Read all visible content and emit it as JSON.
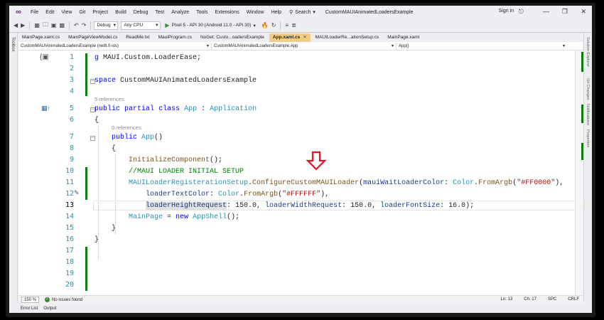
{
  "menu": [
    "File",
    "Edit",
    "View",
    "Git",
    "Project",
    "Build",
    "Debug",
    "Test",
    "Analyze",
    "Tools",
    "Extensions",
    "Window",
    "Help"
  ],
  "search_label": "Search",
  "solution_title": "CustomMAUIAnimatedLoadersExample",
  "sign_in": "Sign in",
  "toolbar": {
    "config": "Debug",
    "platform": "Any CPU",
    "run_target": "Pixel 5 - API 30 (Android 11.0 - API 30)"
  },
  "left_strip_label": "Toolbox",
  "right_strip_labels": [
    "Solution Explorer",
    "Git Changes",
    "Notifications",
    "Properties"
  ],
  "tabs": [
    {
      "label": "MainPage.xaml.cs",
      "active": false
    },
    {
      "label": "MainPageViewModel.cs",
      "active": false
    },
    {
      "label": "ReadMe.txt",
      "active": false
    },
    {
      "label": "MauiProgram.cs",
      "active": false
    },
    {
      "label": "NuGet: Custo...oadersExample",
      "active": false
    },
    {
      "label": "App.xaml.cs",
      "active": true
    },
    {
      "label": "MAUILoaderRe...ationSetup.cs",
      "active": false
    },
    {
      "label": "MainPage.xaml",
      "active": false
    }
  ],
  "nav": {
    "project": "CustomMAUIAnimatedLoadersExample (net8.0-ios)",
    "type": "CustomMAUIAnimatedLoadersExample.App",
    "member": "App()"
  },
  "editor": {
    "line_numbers": [
      "1",
      "2",
      "3",
      "4",
      "5",
      "6",
      "7",
      "8",
      "9",
      "10",
      "11",
      "12",
      "13",
      "14",
      "15",
      "16",
      "17",
      "18",
      "19",
      "20"
    ],
    "current_line": "13",
    "refs_5": "5 references",
    "refs_0": "0 references",
    "l1": {
      "a": "g",
      "b": " MAUI.Custom.LoaderEase;"
    },
    "l3": {
      "a": "space",
      "b": " CustomMAUIAnimatedLoadersExample"
    },
    "l5": {
      "a": "public",
      "b": " ",
      "c": "partial",
      "d": " ",
      "e": "class",
      "f": " ",
      "g": "App",
      "h": " : ",
      "i": "Application"
    },
    "l6": "{",
    "l7": {
      "a": "public",
      "b": " ",
      "c": "App",
      "d": "()"
    },
    "l8": "{",
    "l9": {
      "a": "InitializeComponent",
      "b": "();"
    },
    "l10": "//MAUI LOADER INITIAL SETUP",
    "l11": {
      "a": "MAUILoaderRegisterationSetup",
      "b": ".",
      "c": "ConfigureCustomMAUILoader",
      "d": "(",
      "e": "mauiWaitLoaderColor",
      "f": ": ",
      "g": "Color",
      "h": ".",
      "i": "FromArgb",
      "j": "(",
      "k": "\"#FF0000\"",
      "l": "),"
    },
    "l12": {
      "a": "loaderTextColor",
      "b": ": ",
      "c": "Color",
      "d": ".",
      "e": "FromArgb",
      "f": "(",
      "g": "\"#FFFFFF\"",
      "h": "),"
    },
    "l13": {
      "a": "loaderHeightRequest",
      "b": ": 150.0, ",
      "c": "loaderWidthRequest",
      "d": ": 150.0, ",
      "e": "loaderFontSize",
      "f": ": 16.0);"
    },
    "l14": "}",
    "l15": {
      "a": "MainPage",
      "b": " = ",
      "c": "new",
      "d": " ",
      "e": "AppShell",
      "f": "();"
    },
    "l16": "}",
    "l17": "}"
  },
  "status": {
    "zoom": "150 %",
    "issues": "No issues found",
    "ln": "Ln: 13",
    "ch": "Ch: 17",
    "spc": "SPC",
    "crlf": "CRLF"
  },
  "bottom_tabs": [
    "Error List",
    "Output"
  ],
  "colors": {
    "accent_tab": "#f5cc84",
    "change_bar": "#107c10",
    "arrow": "#e81123"
  }
}
